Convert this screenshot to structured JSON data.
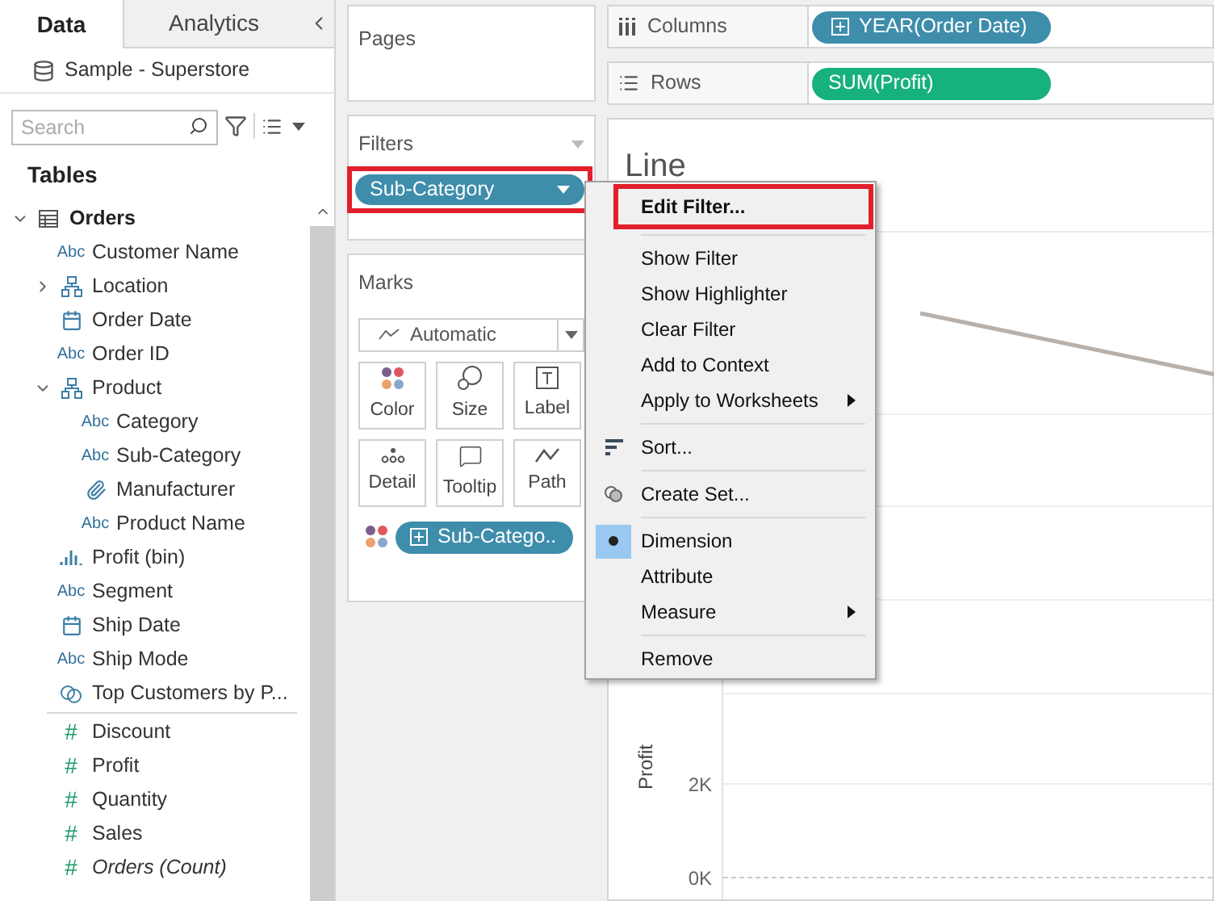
{
  "data_pane": {
    "tabs": [
      {
        "label": "Data",
        "selected": true
      },
      {
        "label": "Analytics",
        "selected": false
      }
    ],
    "data_source": "Sample - Superstore",
    "search": {
      "placeholder": "Search"
    },
    "tables_heading": "Tables",
    "tree": [
      {
        "label": "Orders",
        "kind": "table",
        "expanded": true,
        "children": [
          {
            "label": "Customer Name",
            "kind": "string",
            "icon_text": "Abc"
          },
          {
            "label": "Location",
            "kind": "hierarchy",
            "expanded": false
          },
          {
            "label": "Order Date",
            "kind": "date"
          },
          {
            "label": "Order ID",
            "kind": "string",
            "icon_text": "Abc"
          },
          {
            "label": "Product",
            "kind": "hierarchy",
            "expanded": true,
            "children": [
              {
                "label": "Category",
                "kind": "string",
                "icon_text": "Abc"
              },
              {
                "label": "Sub-Category",
                "kind": "string",
                "icon_text": "Abc"
              },
              {
                "label": "Manufacturer",
                "kind": "group"
              },
              {
                "label": "Product Name",
                "kind": "string",
                "icon_text": "Abc"
              }
            ]
          },
          {
            "label": "Profit (bin)",
            "kind": "bin"
          },
          {
            "label": "Segment",
            "kind": "string",
            "icon_text": "Abc"
          },
          {
            "label": "Ship Date",
            "kind": "date"
          },
          {
            "label": "Ship Mode",
            "kind": "string",
            "icon_text": "Abc"
          },
          {
            "label": "Top Customers by P...",
            "kind": "set"
          },
          {
            "label": "Discount",
            "kind": "number",
            "icon_text": "#",
            "italic": false
          },
          {
            "label": "Profit",
            "kind": "number",
            "icon_text": "#",
            "italic": false
          },
          {
            "label": "Quantity",
            "kind": "number",
            "icon_text": "#",
            "italic": false
          },
          {
            "label": "Sales",
            "kind": "number",
            "icon_text": "#",
            "italic": false
          },
          {
            "label": "Orders (Count)",
            "kind": "number",
            "icon_text": "#",
            "italic": true
          }
        ]
      }
    ]
  },
  "pages": {
    "title": "Pages"
  },
  "filters": {
    "title": "Filters",
    "pills": [
      {
        "label": "Sub-Category",
        "kind": "discrete",
        "highlighted": true
      }
    ]
  },
  "marks": {
    "title": "Marks",
    "mark_type": "Automatic",
    "buttons": [
      {
        "label": "Color",
        "kind": "color"
      },
      {
        "label": "Size",
        "kind": "size"
      },
      {
        "label": "Label",
        "kind": "label"
      },
      {
        "label": "Detail",
        "kind": "detail"
      },
      {
        "label": "Tooltip",
        "kind": "tooltip"
      },
      {
        "label": "Path",
        "kind": "path"
      }
    ],
    "pills": [
      {
        "label": "Sub-Catego..",
        "kind": "discrete"
      }
    ]
  },
  "columns": {
    "label": "Columns",
    "pills": [
      {
        "label": "YEAR(Order Date)",
        "kind": "discrete",
        "expandable": true
      }
    ]
  },
  "rows": {
    "label": "Rows",
    "pills": [
      {
        "label": "SUM(Profit)",
        "kind": "continuous",
        "expandable": false
      }
    ]
  },
  "view": {
    "title": "Line",
    "y_axis_label": "Profit",
    "y_ticks": [
      "2K",
      "0K"
    ]
  },
  "context_menu": {
    "items": [
      {
        "kind": "item",
        "label": "Edit Filter...",
        "default": true,
        "highlighted": true
      },
      {
        "kind": "separator"
      },
      {
        "kind": "item",
        "label": "Show Filter"
      },
      {
        "kind": "item",
        "label": "Show Highlighter"
      },
      {
        "kind": "item",
        "label": "Clear Filter"
      },
      {
        "kind": "item",
        "label": "Add to Context"
      },
      {
        "kind": "item",
        "label": "Apply to Worksheets",
        "submenu": true
      },
      {
        "kind": "separator"
      },
      {
        "kind": "sort",
        "label": "Sort..."
      },
      {
        "kind": "separator"
      },
      {
        "kind": "set",
        "label": "Create Set..."
      },
      {
        "kind": "separator"
      },
      {
        "kind": "radio",
        "label": "Dimension",
        "selected": true
      },
      {
        "kind": "radio",
        "label": "Attribute",
        "selected": false
      },
      {
        "kind": "radio",
        "label": "Measure",
        "selected": false,
        "submenu": true
      },
      {
        "kind": "separator"
      },
      {
        "kind": "item",
        "label": "Remove"
      }
    ]
  }
}
